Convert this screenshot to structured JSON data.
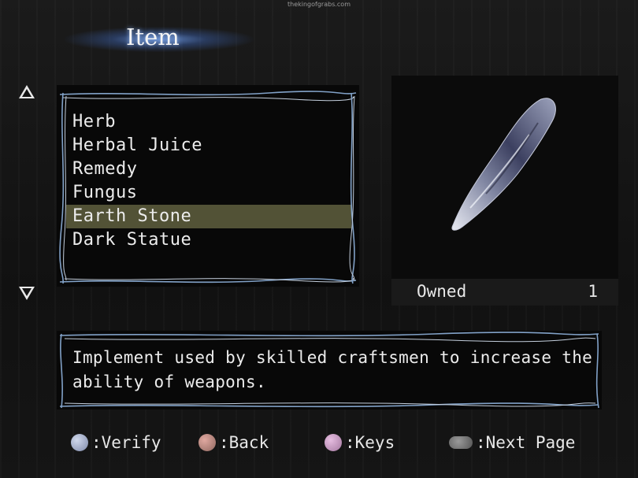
{
  "watermark": "thekingofgrabs.com",
  "header": {
    "title": "Item"
  },
  "items": [
    {
      "label": "Herb",
      "selected": false
    },
    {
      "label": "Herbal Juice",
      "selected": false
    },
    {
      "label": "Remedy",
      "selected": false
    },
    {
      "label": "Fungus",
      "selected": false
    },
    {
      "label": "Earth Stone",
      "selected": true
    },
    {
      "label": "Dark Statue",
      "selected": false
    }
  ],
  "detail": {
    "owned_label": "Owned",
    "owned_count": "1",
    "description_lines": [
      "Implement used by skilled craftsmen to increase the",
      "ability of weapons."
    ]
  },
  "footer": {
    "verify_label": ":Verify",
    "back_label": ":Back",
    "keys_label": ":Keys",
    "next_page_label": ":Next Page"
  },
  "colors": {
    "selection": "#525236",
    "frame": "#8fb2dc",
    "title_glow": "#78aaff"
  }
}
